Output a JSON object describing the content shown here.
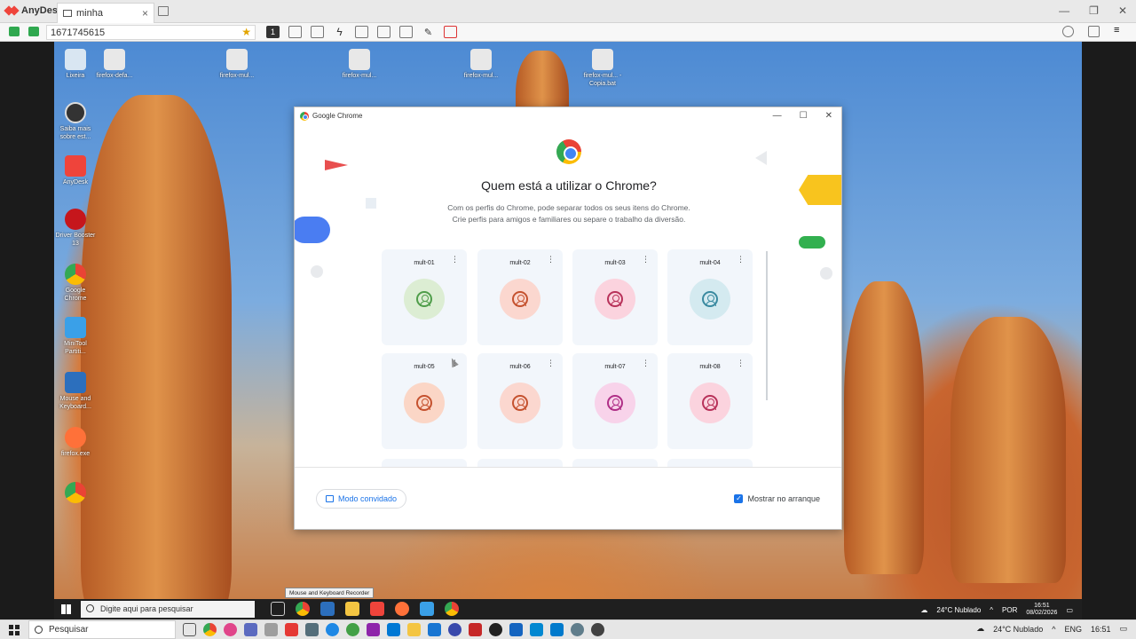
{
  "anydesk": {
    "brand": "AnyDesk",
    "tab_label": "minha",
    "tab_close": "×",
    "address_value": "1671745615",
    "window_buttons": [
      "—",
      "❐",
      "✕"
    ],
    "toolbar_active_label": "1"
  },
  "desktop": {
    "icons": [
      {
        "label": "Lixeira",
        "color": "#d9e6f2"
      },
      {
        "label": "firefox-defa...",
        "color": "#e8e8e8"
      },
      {
        "label": "firefox-mul...",
        "color": "#e8e8e8"
      },
      {
        "label": "firefox-mul...",
        "color": "#e8e8e8"
      },
      {
        "label": "firefox-mul...",
        "color": "#e8e8e8"
      },
      {
        "label": "firefox-mul... - Copia.bat",
        "color": "#e8e8e8"
      },
      {
        "label": "Saiba mais sobre est...",
        "color": "#333333"
      },
      {
        "label": "AnyDesk",
        "color": "#ef443b"
      },
      {
        "label": "Driver Booster 13",
        "color": "#c6161c"
      },
      {
        "label": "Google Chrome",
        "color": "#4285f4"
      },
      {
        "label": "MiniTool Partiti...",
        "color": "#3aa0e8"
      },
      {
        "label": "Mouse and Keyboard...",
        "color": "#2c6fbd"
      },
      {
        "label": "firefox.exe",
        "color": "#ff7139"
      },
      {
        "label": "",
        "color": "#4285f4"
      }
    ]
  },
  "chrome_window": {
    "title": "Google Chrome",
    "window_buttons": [
      "—",
      "☐",
      "✕"
    ],
    "heading": "Quem está a utilizar o Chrome?",
    "subtitle_line1": "Com os perfis do Chrome, pode separar todos os seus itens do Chrome.",
    "subtitle_line2": "Crie perfis para amigos e familiares ou separe o trabalho da diversão.",
    "profiles": [
      {
        "name": "mult-01",
        "bg": "#dcedd3",
        "fg": "#4f9d4a"
      },
      {
        "name": "mult-02",
        "bg": "#fbd7cf",
        "fg": "#c5522f"
      },
      {
        "name": "mult-03",
        "bg": "#fbd3de",
        "fg": "#b8325a"
      },
      {
        "name": "mult-04",
        "bg": "#d4eaf0",
        "fg": "#3a8aa0"
      },
      {
        "name": "mult-05",
        "bg": "#fbd6c6",
        "fg": "#c5522f"
      },
      {
        "name": "mult-06",
        "bg": "#fbd7cf",
        "fg": "#c5522f"
      },
      {
        "name": "mult-07",
        "bg": "#f8d3ea",
        "fg": "#b02f87"
      },
      {
        "name": "mult-08",
        "bg": "#fbd3de",
        "fg": "#b8325a"
      }
    ],
    "more_glyph": "⋮",
    "guest_label": "Modo convidado",
    "startup_label": "Mostrar no arranque",
    "startup_checked": true,
    "check_glyph": "✓"
  },
  "remote_taskbar": {
    "search_placeholder": "Digite aqui para pesquisar",
    "tooltip": "Mouse and Keyboard Recorder",
    "weather": "24°C  Nublado",
    "lang": "POR",
    "time": "16:51",
    "date": "08/02/2026"
  },
  "local_taskbar": {
    "search_placeholder": "Pesquisar",
    "weather": "24°C  Nublado",
    "lang": "ENG",
    "time": "16:51"
  }
}
